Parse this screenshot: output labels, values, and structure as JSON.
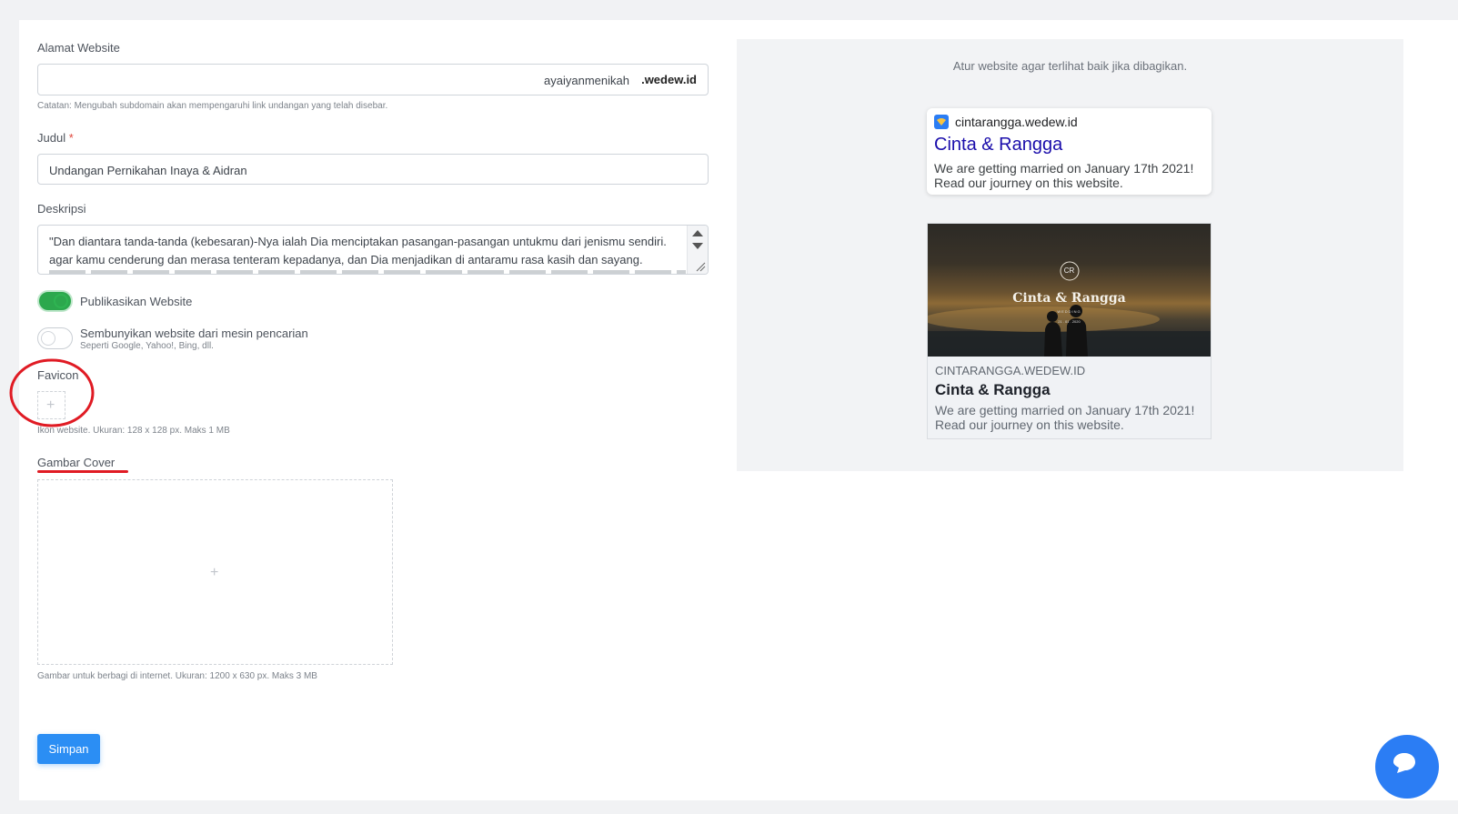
{
  "form": {
    "address_label": "Alamat Website",
    "subdomain_value": "ayaiyanmenikah",
    "domain_suffix": ".wedew.id",
    "address_note": "Catatan: Mengubah subdomain akan mempengaruhi link undangan yang telah disebar.",
    "title_label": "Judul",
    "required_mark": "*",
    "title_value": "Undangan Pernikahan Inaya & Aidran",
    "desc_label": "Deskripsi",
    "desc_line1": "\"Dan diantara tanda-tanda (kebesaran)-Nya ialah Dia menciptakan pasangan-pasangan untukmu dari jenismu sendiri.",
    "desc_line2": "agar kamu cenderung dan merasa tenteram kepadanya, dan Dia menjadikan di antaramu rasa kasih dan sayang.",
    "publish_label": "Publikasikan Website",
    "publish_on": true,
    "hide_label": "Sembunyikan website dari mesin pencarian",
    "hide_sub": "Seperti Google, Yahoo!, Bing, dll.",
    "hide_on": false,
    "favicon_label": "Favicon",
    "favicon_hint": "Ikon website. Ukuran: 128 x 128 px. Maks 1 MB",
    "cover_label": "Gambar Cover",
    "cover_hint": "Gambar untuk berbagi di internet. Ukuran: 1200 x 630 px. Maks 3 MB",
    "save_label": "Simpan",
    "plus_glyph": "+"
  },
  "preview": {
    "intro": "Atur website agar terlihat baik jika dibagikan.",
    "google": {
      "url": "cintarangga.wedew.id",
      "title": "Cinta & Rangga",
      "desc": "We are getting married on January 17th 2021! Read our journey on this website."
    },
    "facebook": {
      "image_monogram": "CR",
      "image_title": "Cinta & Rangga",
      "image_sub": "WEDDING",
      "image_date": "21 . 01 . 2020",
      "domain": "CINTARANGGA.WEDEW.ID",
      "title": "Cinta & Rangga",
      "desc": "We are getting married on January 17th 2021! Read our journey on this website."
    }
  },
  "colors": {
    "accent": "#2b8ef4",
    "toggle_on": "#2ca84d",
    "annotation_red": "#e01b24",
    "google_title": "#1a0dab"
  }
}
